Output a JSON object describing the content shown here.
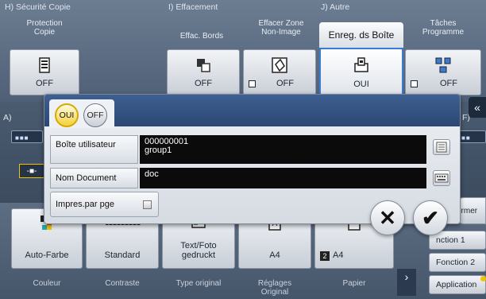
{
  "sections": {
    "h_label": "H)  Sécurité Copie",
    "i_label": "I)   Effacement",
    "j_label": "J)  Autre"
  },
  "tabs": {
    "protection": "Protection\nCopie",
    "effac_bords": "Effac. Bords",
    "effacer_zone": "Effacer Zone\nNon-Image",
    "enreg_boite": "Enreg. ds Boîte",
    "taches": "Tâches\nProgramme"
  },
  "function_buttons": {
    "protection": "OFF",
    "effac_bords": "OFF",
    "effacer_zone": "OFF",
    "enreg_boite": "OUI",
    "taches": "OFF"
  },
  "bg_mid": {
    "a_label": "A)",
    "right_label": "F)",
    "collapse_icon": "double-chevron-left-icon"
  },
  "dialog": {
    "toggle_on": "OUI",
    "toggle_off": "OFF",
    "box_label": "Boîte utilisateur",
    "box_value_1": "000000001",
    "box_value_2": "group1",
    "name_label": "Nom Document",
    "name_value": "doc",
    "print_label": "Impres.par pge"
  },
  "bottom_buttons": {
    "color": "Auto-Farbe",
    "contrast": "Standard",
    "original": "Text/Foto\ngedruckt",
    "reglages": "A4",
    "papier": "A4"
  },
  "captions": {
    "couleur": "Couleur",
    "contraste": "Contraste",
    "type_original": "Type original",
    "reglages": "Réglages\nOriginal",
    "papier": "Papier"
  },
  "side": {
    "fermer": "ermer",
    "fonction1": "nction 1",
    "fonction2": "Fonction 2",
    "application": "Application"
  },
  "colors": {
    "accent": "#3a7bd5",
    "dialog_header": "#2c4774",
    "toggle_on": "#f4d13a"
  }
}
